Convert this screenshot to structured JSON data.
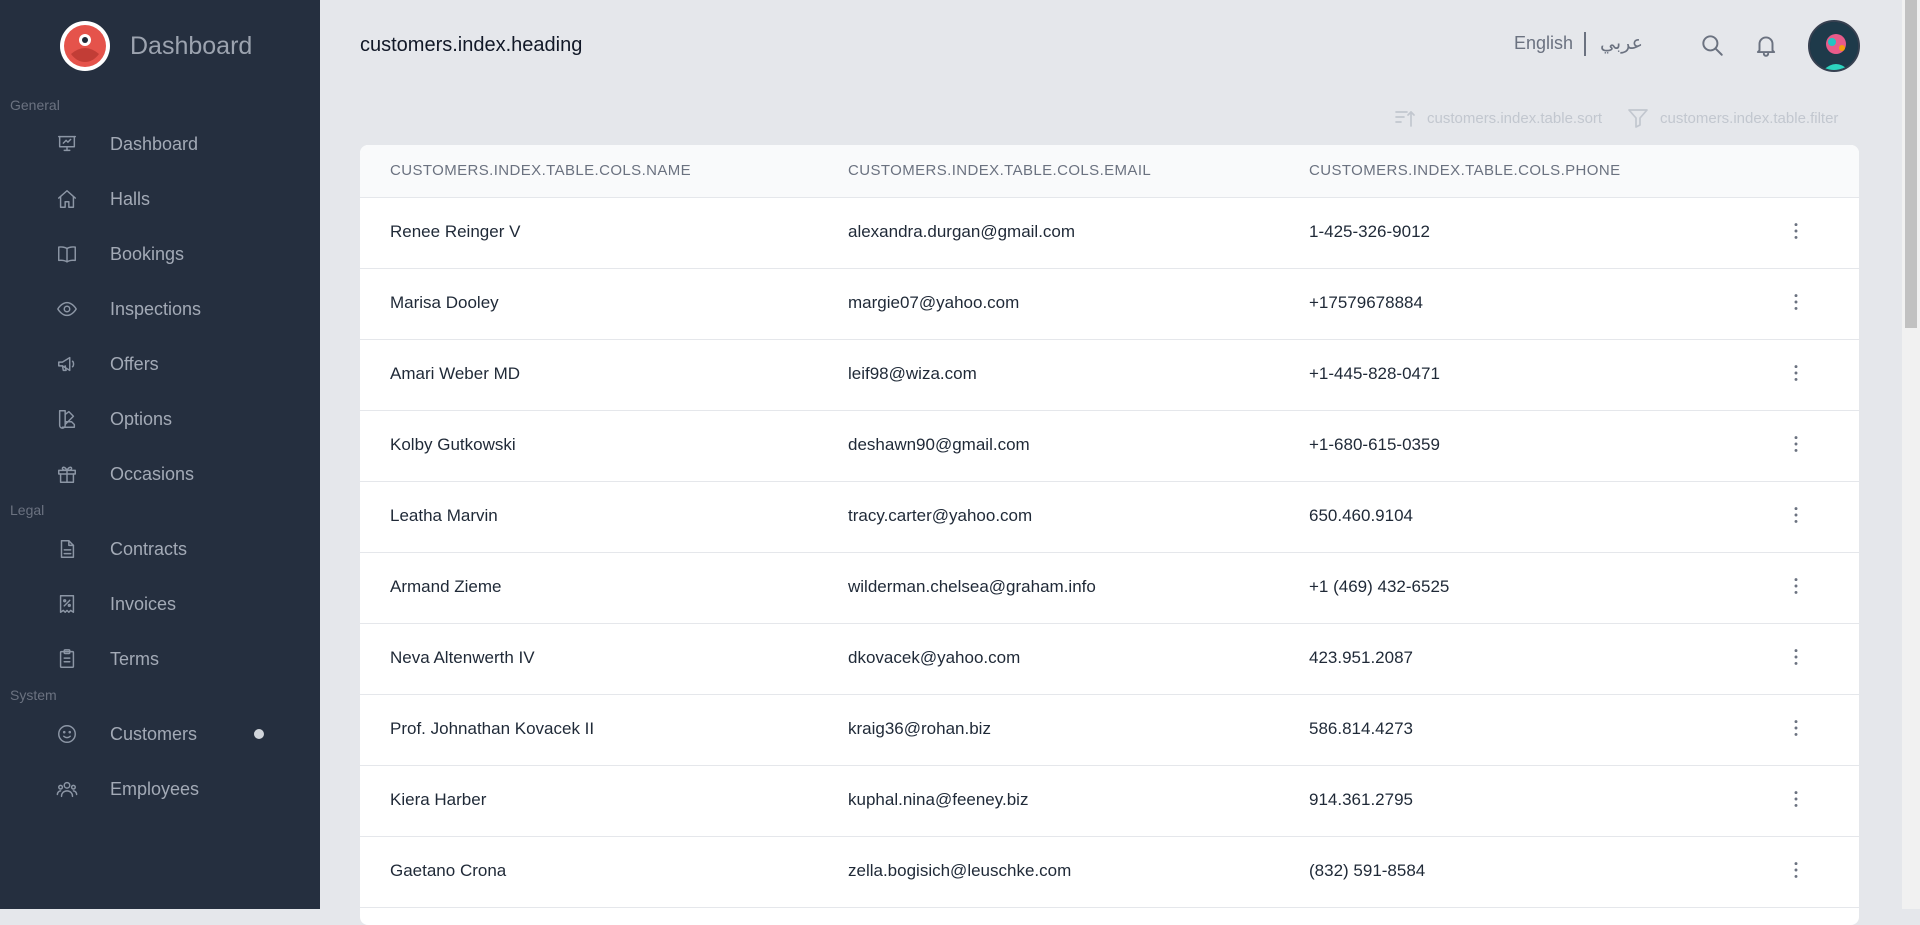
{
  "sidebar": {
    "brand": "Dashboard",
    "sections": {
      "general": "General",
      "legal": "Legal",
      "system": "System"
    },
    "items": [
      {
        "label": "Dashboard",
        "icon": "presentation-chart-icon"
      },
      {
        "label": "Halls",
        "icon": "home-icon"
      },
      {
        "label": "Bookings",
        "icon": "book-open-icon"
      },
      {
        "label": "Inspections",
        "icon": "eye-icon"
      },
      {
        "label": "Offers",
        "icon": "megaphone-icon"
      },
      {
        "label": "Options",
        "icon": "color-swatch-icon"
      },
      {
        "label": "Occasions",
        "icon": "gift-icon"
      },
      {
        "label": "Contracts",
        "icon": "document-text-icon"
      },
      {
        "label": "Invoices",
        "icon": "receipt-icon"
      },
      {
        "label": "Terms",
        "icon": "clipboard-list-icon"
      },
      {
        "label": "Customers",
        "icon": "emoji-happy-icon",
        "active": true
      },
      {
        "label": "Employees",
        "icon": "user-group-icon"
      }
    ]
  },
  "header": {
    "title": "customers.index.heading",
    "lang_en": "English",
    "lang_ar": "عربي"
  },
  "toolbar": {
    "sort_label": "customers.index.table.sort",
    "filter_label": "customers.index.table.filter"
  },
  "table": {
    "columns": [
      "customers.index.table.cols.name",
      "customers.index.table.cols.email",
      "customers.index.table.cols.phone"
    ],
    "rows": [
      {
        "name": "Renee Reinger V",
        "email": "alexandra.durgan@gmail.com",
        "phone": "1-425-326-9012"
      },
      {
        "name": "Marisa Dooley",
        "email": "margie07@yahoo.com",
        "phone": "+17579678884"
      },
      {
        "name": "Amari Weber MD",
        "email": "leif98@wiza.com",
        "phone": "+1-445-828-0471"
      },
      {
        "name": "Kolby Gutkowski",
        "email": "deshawn90@gmail.com",
        "phone": "+1-680-615-0359"
      },
      {
        "name": "Leatha Marvin",
        "email": "tracy.carter@yahoo.com",
        "phone": "650.460.9104"
      },
      {
        "name": "Armand Zieme",
        "email": "wilderman.chelsea@graham.info",
        "phone": "+1 (469) 432-6525"
      },
      {
        "name": "Neva Altenwerth IV",
        "email": "dkovacek@yahoo.com",
        "phone": "423.951.2087"
      },
      {
        "name": "Prof. Johnathan Kovacek II",
        "email": "kraig36@rohan.biz",
        "phone": "586.814.4273"
      },
      {
        "name": "Kiera Harber",
        "email": "kuphal.nina@feeney.biz",
        "phone": "914.361.2795"
      },
      {
        "name": "Gaetano Crona",
        "email": "zella.bogisich@leuschke.com",
        "phone": "(832) 591-8584"
      }
    ]
  },
  "colors": {
    "sidebar_bg": "#252f3f",
    "page_bg": "#e5e7eb",
    "logo_red": "#e5534b"
  }
}
